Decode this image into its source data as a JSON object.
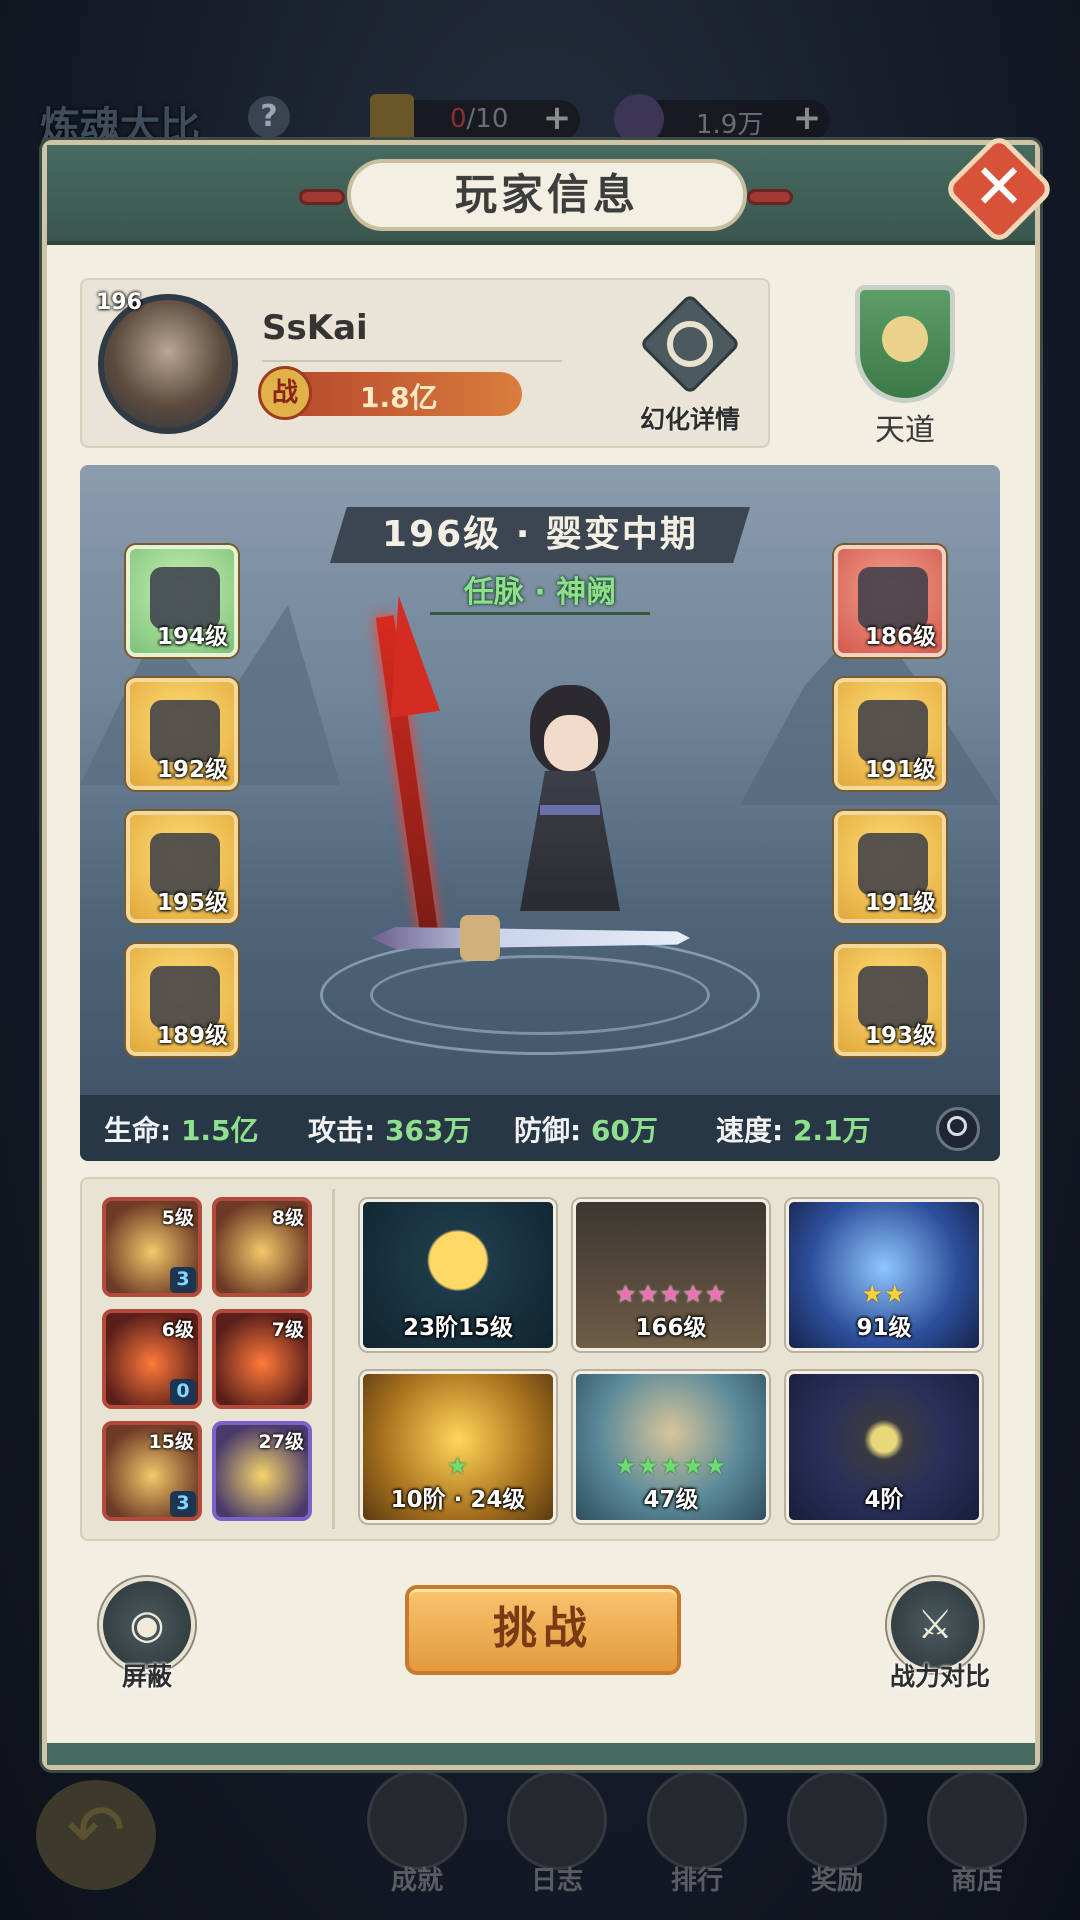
{
  "top": {
    "mode_title": "炼魂大比",
    "help": "?",
    "resource1": {
      "current": "0",
      "max": "/10"
    },
    "resource2": {
      "amount": "1.9万"
    },
    "plus": "+"
  },
  "dialog": {
    "title": "玩家信息",
    "close": "✕"
  },
  "player": {
    "level": "196",
    "name": "SsKai",
    "power_badge": "战",
    "power": "1.8亿",
    "morph_label": "幻化详情",
    "rank_label": "天道"
  },
  "stage": {
    "realm": "196级 · 婴变中期",
    "meridian": "任脉 · 神阙",
    "equipment_left": [
      {
        "level": "194级",
        "rarity": "green",
        "icon": "helmet-icon"
      },
      {
        "level": "192级",
        "rarity": "gold",
        "icon": "armor-icon"
      },
      {
        "level": "195级",
        "rarity": "gold",
        "icon": "weapon-hilt-icon"
      },
      {
        "level": "189级",
        "rarity": "gold",
        "icon": "gauntlet-icon"
      }
    ],
    "equipment_right": [
      {
        "level": "186级",
        "rarity": "red",
        "icon": "belt-icon"
      },
      {
        "level": "191级",
        "rarity": "gold",
        "icon": "greaves-icon"
      },
      {
        "level": "191级",
        "rarity": "gold",
        "icon": "boots-icon"
      },
      {
        "level": "193级",
        "rarity": "gold",
        "icon": "ring-icon"
      }
    ],
    "stats": [
      {
        "label": "生命:",
        "value": "1.5亿"
      },
      {
        "label": "攻击:",
        "value": "363万"
      },
      {
        "label": "防御:",
        "value": "60万"
      },
      {
        "label": "速度:",
        "value": "2.1万"
      }
    ]
  },
  "skills": [
    {
      "level": "5级",
      "count": "3",
      "style": "gold"
    },
    {
      "level": "8级",
      "count": "",
      "style": "gold"
    },
    {
      "level": "6级",
      "count": "0",
      "style": "red"
    },
    {
      "level": "7级",
      "count": "",
      "style": "red"
    },
    {
      "level": "15级",
      "count": "3",
      "style": "gold"
    },
    {
      "level": "27级",
      "count": "",
      "style": "purple"
    }
  ],
  "cards": [
    {
      "label": "23阶15级",
      "stars": "",
      "star_style": ""
    },
    {
      "label": "166级",
      "stars": "★★★★★",
      "star_style": "pink"
    },
    {
      "label": "91级",
      "stars": "★★",
      "star_style": "gold"
    },
    {
      "label": "10阶 · 24级",
      "stars": "★",
      "star_style": "green"
    },
    {
      "label": "47级",
      "stars": "★★★★★",
      "star_style": "green"
    },
    {
      "label": "4阶",
      "stars": "",
      "star_style": ""
    }
  ],
  "actions": {
    "hide": "屏蔽",
    "challenge": "挑战",
    "compare": "战力对比"
  },
  "nav": {
    "achievements": "成就",
    "log": "日志",
    "ranking": "排行",
    "rewards": "奖励",
    "shop": "商店"
  }
}
